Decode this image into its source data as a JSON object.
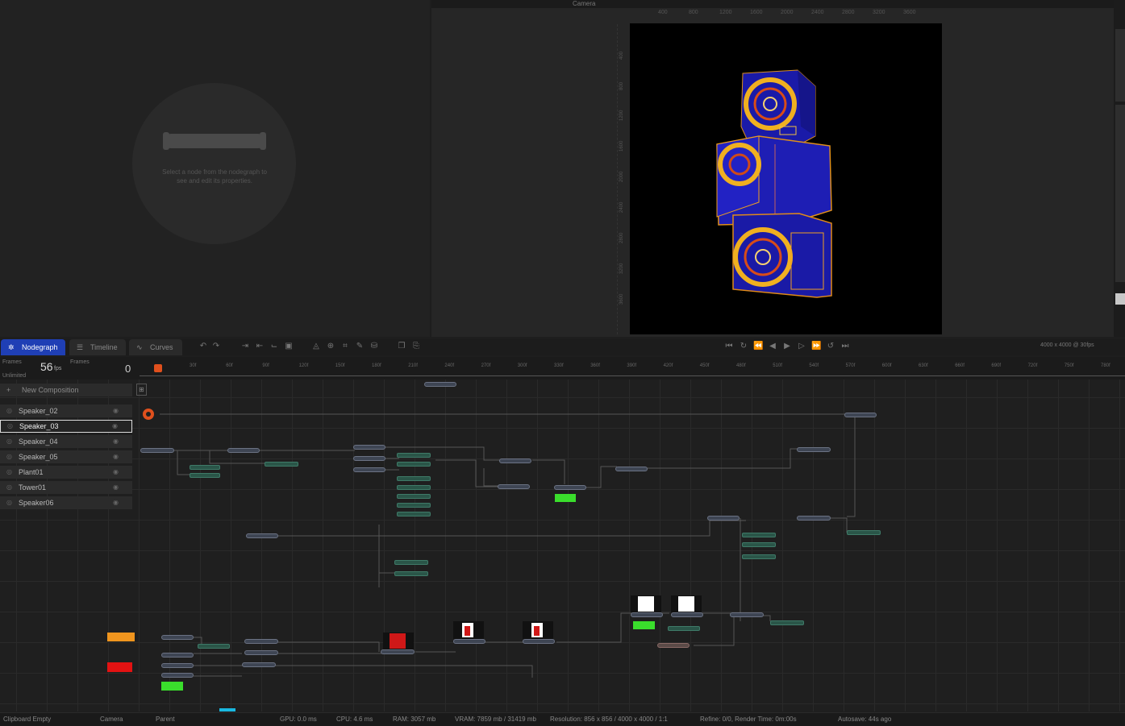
{
  "properties_panel": {
    "empty_hint": "Select a node from the nodegraph to see and edit its properties."
  },
  "viewer": {
    "camera_label": "Camera",
    "ruler_h": [
      "400",
      "800",
      "1200",
      "1600",
      "2000",
      "2400",
      "2800",
      "3200",
      "3600"
    ],
    "ruler_v": [
      "400",
      "800",
      "1200",
      "1600",
      "2000",
      "2400",
      "2800",
      "3200",
      "3600"
    ]
  },
  "tabs": [
    {
      "label": "Nodegraph",
      "icon": "nodegraph-icon",
      "active": true
    },
    {
      "label": "Timeline",
      "icon": "timeline-icon",
      "active": false
    },
    {
      "label": "Curves",
      "icon": "curves-icon",
      "active": false
    }
  ],
  "toolbar": {
    "resolution_info": "4000 x 4000 @ 30fps"
  },
  "frames": {
    "frames_label": "Frames",
    "frames_label_2": "Frames",
    "unlimited_label": "Unlimited",
    "fps_value": "56",
    "fps_unit": "fps",
    "current_frame": "0",
    "ruler_labels": [
      "30f",
      "60f",
      "90f",
      "120f",
      "150f",
      "180f",
      "210f",
      "240f",
      "270f",
      "300f",
      "330f",
      "360f",
      "390f",
      "420f",
      "450f",
      "480f",
      "510f",
      "540f",
      "570f",
      "600f",
      "630f",
      "660f",
      "690f",
      "720f",
      "750f",
      "780f"
    ]
  },
  "layers": {
    "new_composition": "New Composition",
    "items": [
      {
        "name": "Speaker_02",
        "selected": false
      },
      {
        "name": "Speaker_03",
        "selected": true
      },
      {
        "name": "Speaker_04",
        "selected": false
      },
      {
        "name": "Speaker_05",
        "selected": false
      },
      {
        "name": "Plant01",
        "selected": false
      },
      {
        "name": "Tower01",
        "selected": false
      },
      {
        "name": "Speaker06",
        "selected": false
      }
    ]
  },
  "status": {
    "clipboard": "Clipboard Empty",
    "camera": "Camera",
    "parent": "Parent",
    "gpu": "GPU: 0.0 ms",
    "cpu": "CPU: 4.6 ms",
    "ram": "RAM: 3057 mb",
    "vram": "VRAM: 7859 mb / 31419 mb",
    "resolution": "Resolution: 856 x 856 / 4000 x 4000 / 1:1",
    "refine": "Refine: 0/0, Render Time: 0m:00s",
    "autosave": "Autosave: 44s ago"
  },
  "colors": {
    "accent": "#1f3fb5",
    "playhead": "#e0501d",
    "node_green": "#3ade2c",
    "swatch_orange": "#f0951e",
    "swatch_red": "#e31212"
  }
}
